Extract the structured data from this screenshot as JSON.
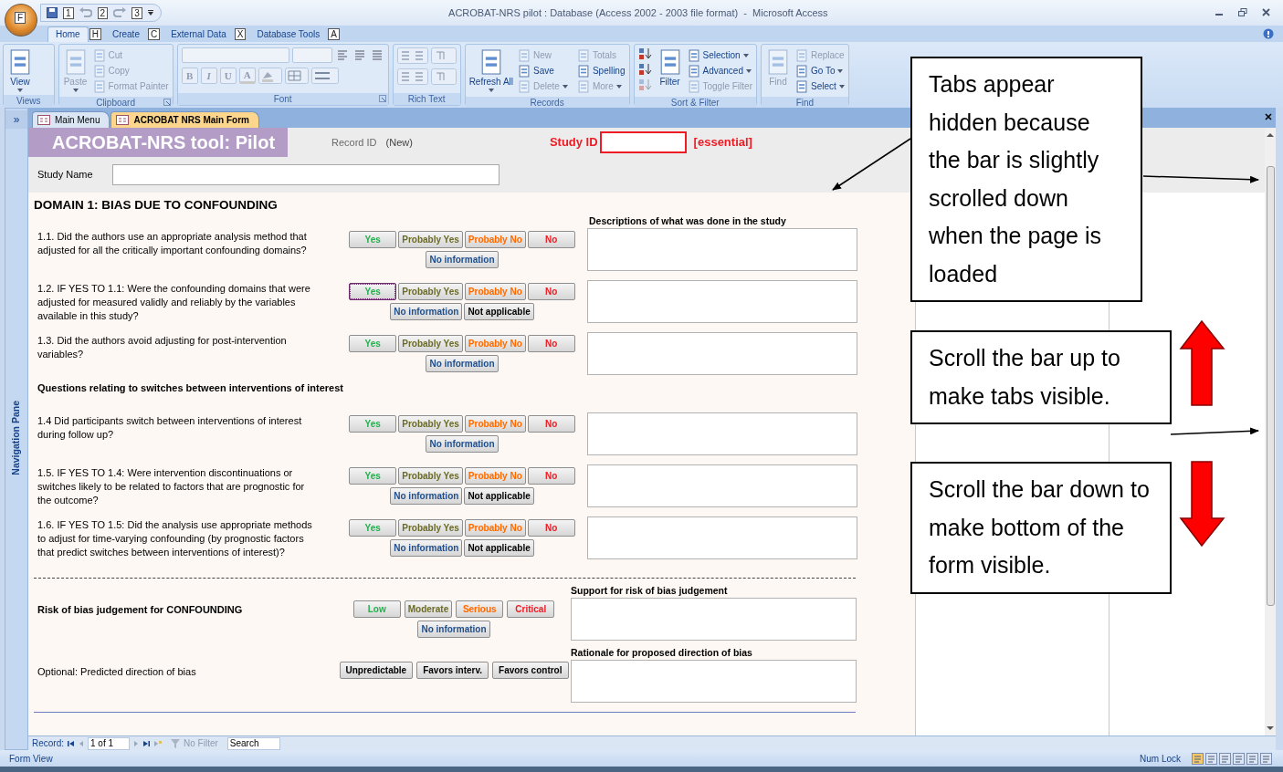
{
  "window": {
    "title": "ACROBAT-NRS pilot : Database (Access 2002 - 2003 file format)  -  Microsoft Access",
    "office_keytip": "F",
    "quick_access_keytips": [
      "1",
      "2",
      "3"
    ]
  },
  "ribbon_tabs": [
    {
      "label": "Home",
      "keytip": "H",
      "selected": true
    },
    {
      "label": "Create",
      "keytip": "C",
      "selected": false
    },
    {
      "label": "External Data",
      "keytip": "X",
      "selected": false
    },
    {
      "label": "Database Tools",
      "keytip": "A",
      "selected": false
    }
  ],
  "ribbon_groups": [
    {
      "kind": "commands",
      "label": "Views",
      "launcher": false,
      "commands": [
        {
          "kind": "large",
          "label": "View",
          "disabled": false,
          "dropdown": true
        }
      ]
    },
    {
      "kind": "commands",
      "label": "Clipboard",
      "launcher": true,
      "commands": [
        {
          "kind": "large",
          "label": "Paste",
          "disabled": true,
          "dropdown": true
        },
        {
          "kind": "small",
          "label": "Cut",
          "disabled": true,
          "dropdown": false
        },
        {
          "kind": "small",
          "label": "Copy",
          "disabled": true,
          "dropdown": false
        },
        {
          "kind": "small",
          "label": "Format Painter",
          "disabled": true,
          "dropdown": false
        }
      ]
    },
    {
      "kind": "font",
      "label": "Font",
      "launcher": true,
      "format_buttons": [
        "B",
        "I",
        "U"
      ],
      "color_button": "A"
    },
    {
      "kind": "rich_text",
      "label": "Rich Text",
      "launcher": false
    },
    {
      "kind": "commands",
      "label": "Records",
      "launcher": false,
      "commands": [
        {
          "kind": "large",
          "label": "Refresh All",
          "disabled": false,
          "dropdown": true
        },
        {
          "kind": "small",
          "label": "New",
          "disabled": true,
          "dropdown": false
        },
        {
          "kind": "small",
          "label": "Save",
          "disabled": false,
          "dropdown": false
        },
        {
          "kind": "small",
          "label": "Delete",
          "disabled": true,
          "dropdown": true
        },
        {
          "kind": "small",
          "label": "Totals",
          "disabled": true,
          "dropdown": false
        },
        {
          "kind": "small",
          "label": "Spelling",
          "disabled": false,
          "dropdown": false
        },
        {
          "kind": "small",
          "label": "More",
          "disabled": true,
          "dropdown": true
        }
      ]
    },
    {
      "kind": "sort",
      "label": "Sort & Filter",
      "launcher": false,
      "commands": [
        {
          "kind": "large",
          "label": "Filter",
          "disabled": false,
          "dropdown": false
        },
        {
          "kind": "small",
          "label": "Selection",
          "disabled": false,
          "dropdown": true
        },
        {
          "kind": "small",
          "label": "Advanced",
          "disabled": false,
          "dropdown": true
        },
        {
          "kind": "small",
          "label": "Toggle Filter",
          "disabled": true,
          "dropdown": false
        }
      ]
    },
    {
      "kind": "commands",
      "label": "Find",
      "launcher": false,
      "commands": [
        {
          "kind": "large",
          "label": "Find",
          "disabled": true,
          "dropdown": false
        },
        {
          "kind": "small",
          "label": "Replace",
          "disabled": true,
          "dropdown": false
        },
        {
          "kind": "small",
          "label": "Go To",
          "disabled": false,
          "dropdown": true
        },
        {
          "kind": "small",
          "label": "Select",
          "disabled": false,
          "dropdown": true
        }
      ]
    }
  ],
  "nav_pane": {
    "toggle": "»",
    "label": "Navigation Pane"
  },
  "document_tabs": [
    {
      "label": "Main Menu",
      "selected": false
    },
    {
      "label": "ACROBAT NRS Main Form",
      "selected": true
    }
  ],
  "form": {
    "title": "ACROBAT-NRS tool: Pilot",
    "record_id_label": "Record ID",
    "record_id_value": "(New)",
    "study_id_label": "Study ID",
    "study_id_note": "[essential]",
    "study_name_label": "Study Name",
    "domain_title": "DOMAIN 1: BIAS DUE TO CONFOUNDING",
    "sections": [
      {
        "kind": "question",
        "box_heading": "Descriptions of what was done in the study",
        "text": "1.1. Did the authors use an appropriate analysis method that adjusted for all the critically important confounding domains?",
        "options": [
          {
            "label": "Yes",
            "color": "#22b14c",
            "focused": false
          },
          {
            "label": "Probably Yes",
            "color": "#6b6b26",
            "focused": false
          },
          {
            "label": "Probably No",
            "color": "#ff6a00",
            "focused": false
          },
          {
            "label": "No",
            "color": "#ed1c24",
            "focused": false
          }
        ],
        "extra_options": [
          {
            "label": "No information",
            "color": "#1f4e8c",
            "focused": false
          }
        ]
      },
      {
        "kind": "question",
        "text": "1.2. IF YES TO 1.1:  Were the confounding domains that were adjusted for measured validly and reliably by the variables available in this study?",
        "options": [
          {
            "label": "Yes",
            "color": "#22b14c",
            "focused": true
          },
          {
            "label": "Probably Yes",
            "color": "#6b6b26",
            "focused": false
          },
          {
            "label": "Probably No",
            "color": "#ff6a00",
            "focused": false
          },
          {
            "label": "No",
            "color": "#ed1c24",
            "focused": false
          }
        ],
        "extra_options": [
          {
            "label": "No information",
            "color": "#1f4e8c",
            "focused": false
          },
          {
            "label": "Not applicable",
            "color": "#000000",
            "focused": false
          }
        ]
      },
      {
        "kind": "question",
        "text": "1.3. Did the authors avoid adjusting for post-intervention variables?",
        "options": [
          {
            "label": "Yes",
            "color": "#22b14c",
            "focused": false
          },
          {
            "label": "Probably Yes",
            "color": "#6b6b26",
            "focused": false
          },
          {
            "label": "Probably No",
            "color": "#ff6a00",
            "focused": false
          },
          {
            "label": "No",
            "color": "#ed1c24",
            "focused": false
          }
        ],
        "extra_options": [
          {
            "label": "No information",
            "color": "#1f4e8c",
            "focused": false
          }
        ]
      },
      {
        "kind": "heading",
        "text": "Questions relating to switches between interventions of interest"
      },
      {
        "kind": "question",
        "text": "1.4 Did participants switch between interventions of interest during follow up?",
        "options": [
          {
            "label": "Yes",
            "color": "#22b14c",
            "focused": false
          },
          {
            "label": "Probably Yes",
            "color": "#6b6b26",
            "focused": false
          },
          {
            "label": "Probably No",
            "color": "#ff6a00",
            "focused": false
          },
          {
            "label": "No",
            "color": "#ed1c24",
            "focused": false
          }
        ],
        "extra_options": [
          {
            "label": "No information",
            "color": "#1f4e8c",
            "focused": false
          }
        ]
      },
      {
        "kind": "question",
        "text": "1.5.  IF YES TO 1.4: Were intervention discontinuations or switches likely to be related to factors that are prognostic for the outcome?",
        "options": [
          {
            "label": "Yes",
            "color": "#22b14c",
            "focused": false
          },
          {
            "label": "Probably Yes",
            "color": "#6b6b26",
            "focused": false
          },
          {
            "label": "Probably No",
            "color": "#ff6a00",
            "focused": false
          },
          {
            "label": "No",
            "color": "#ed1c24",
            "focused": false
          }
        ],
        "extra_options": [
          {
            "label": "No information",
            "color": "#1f4e8c",
            "focused": false
          },
          {
            "label": "Not applicable",
            "color": "#000000",
            "focused": false
          }
        ]
      },
      {
        "kind": "question",
        "text": "1.6. IF YES TO 1.5:  Did the analysis use appropriate methods to adjust for time-varying confounding (by prognostic factors that predict switches between interventions of interest)?",
        "options": [
          {
            "label": "Yes",
            "color": "#22b14c",
            "focused": false
          },
          {
            "label": "Probably Yes",
            "color": "#6b6b26",
            "focused": false
          },
          {
            "label": "Probably No",
            "color": "#ff6a00",
            "focused": false
          },
          {
            "label": "No",
            "color": "#ed1c24",
            "focused": false
          }
        ],
        "extra_options": [
          {
            "label": "No information",
            "color": "#1f4e8c",
            "focused": false
          },
          {
            "label": "Not applicable",
            "color": "#000000",
            "focused": false
          }
        ]
      },
      {
        "kind": "divider"
      },
      {
        "kind": "judgement",
        "box_heading": "Support for risk of bias judgement",
        "text": "Risk of bias judgement for CONFOUNDING",
        "options": [
          {
            "label": "Low",
            "color": "#22b14c",
            "focused": false
          },
          {
            "label": "Moderate",
            "color": "#6b6b26",
            "focused": false
          },
          {
            "label": "Serious",
            "color": "#ff6a00",
            "focused": false
          },
          {
            "label": "Critical",
            "color": "#ed1c24",
            "focused": false
          }
        ],
        "extra_options": [
          {
            "label": "No information",
            "color": "#1f4e8c",
            "focused": false
          }
        ]
      },
      {
        "kind": "direction",
        "box_heading": "Rationale for proposed direction of bias",
        "text": "Optional: Predicted direction of bias",
        "options": [
          {
            "label": "Unpredictable",
            "color": "#000000",
            "focused": false
          },
          {
            "label": "Favors interv.",
            "color": "#000000",
            "focused": false
          },
          {
            "label": "Favors control",
            "color": "#000000",
            "focused": false
          }
        ]
      }
    ]
  },
  "record_nav": {
    "label": "Record:",
    "position": "1 of 1",
    "filter": "No Filter",
    "search_placeholder": "Search"
  },
  "status_bar": {
    "left": "Form View",
    "right": "Num Lock"
  },
  "annotations": [
    {
      "text": "Tabs appear hidden because the bar is slightly scrolled down when the page is loaded"
    },
    {
      "text": "Scroll the bar up to make tabs visible."
    },
    {
      "text": "Scroll the bar down to make bottom of the form visible."
    }
  ]
}
